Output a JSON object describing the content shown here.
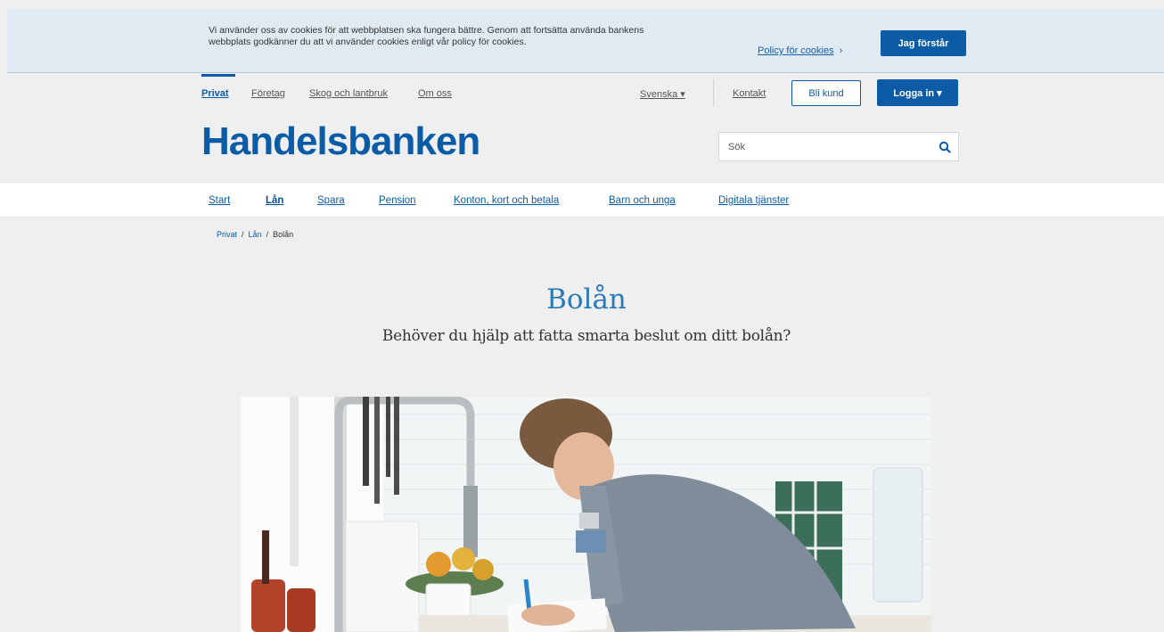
{
  "cookie_banner": {
    "text": "Vi använder oss av cookies för att webbplatsen ska fungera bättre. Genom att fortsätta använda bankens webbplats godkänner du att vi använder cookies enligt vår policy för cookies.",
    "policy_link": "Policy för cookies",
    "accept_button": "Jag förstår"
  },
  "top_nav": {
    "items": [
      "Privat",
      "Företag",
      "Skog och lantbruk",
      "Om oss"
    ],
    "active": "Privat",
    "language": "Svenska ▾",
    "contact": "Kontakt",
    "become_customer": "Bli kund",
    "login": "Logga in ▾"
  },
  "logo": {
    "text": "Handelsbanken"
  },
  "search": {
    "placeholder": "Sök"
  },
  "main_nav": {
    "items": [
      "Start",
      "Lån",
      "Spara",
      "Pension",
      "Konton, kort och betala",
      "Barn och unga",
      "Digitala tjänster"
    ],
    "active": "Lån"
  },
  "breadcrumb": [
    "Privat",
    "Lån",
    "Bolån"
  ],
  "hero": {
    "title": "Bolån",
    "subtitle": "Behöver du hjälp att fatta smarta beslut om ditt bolån?"
  },
  "colors": {
    "brand_blue": "#0b5ba7",
    "cookie_bg": "#dfeaf2",
    "page_bg": "#efefef"
  },
  "icons": {
    "search": "search-icon",
    "chevron": "chevron-right-icon"
  }
}
